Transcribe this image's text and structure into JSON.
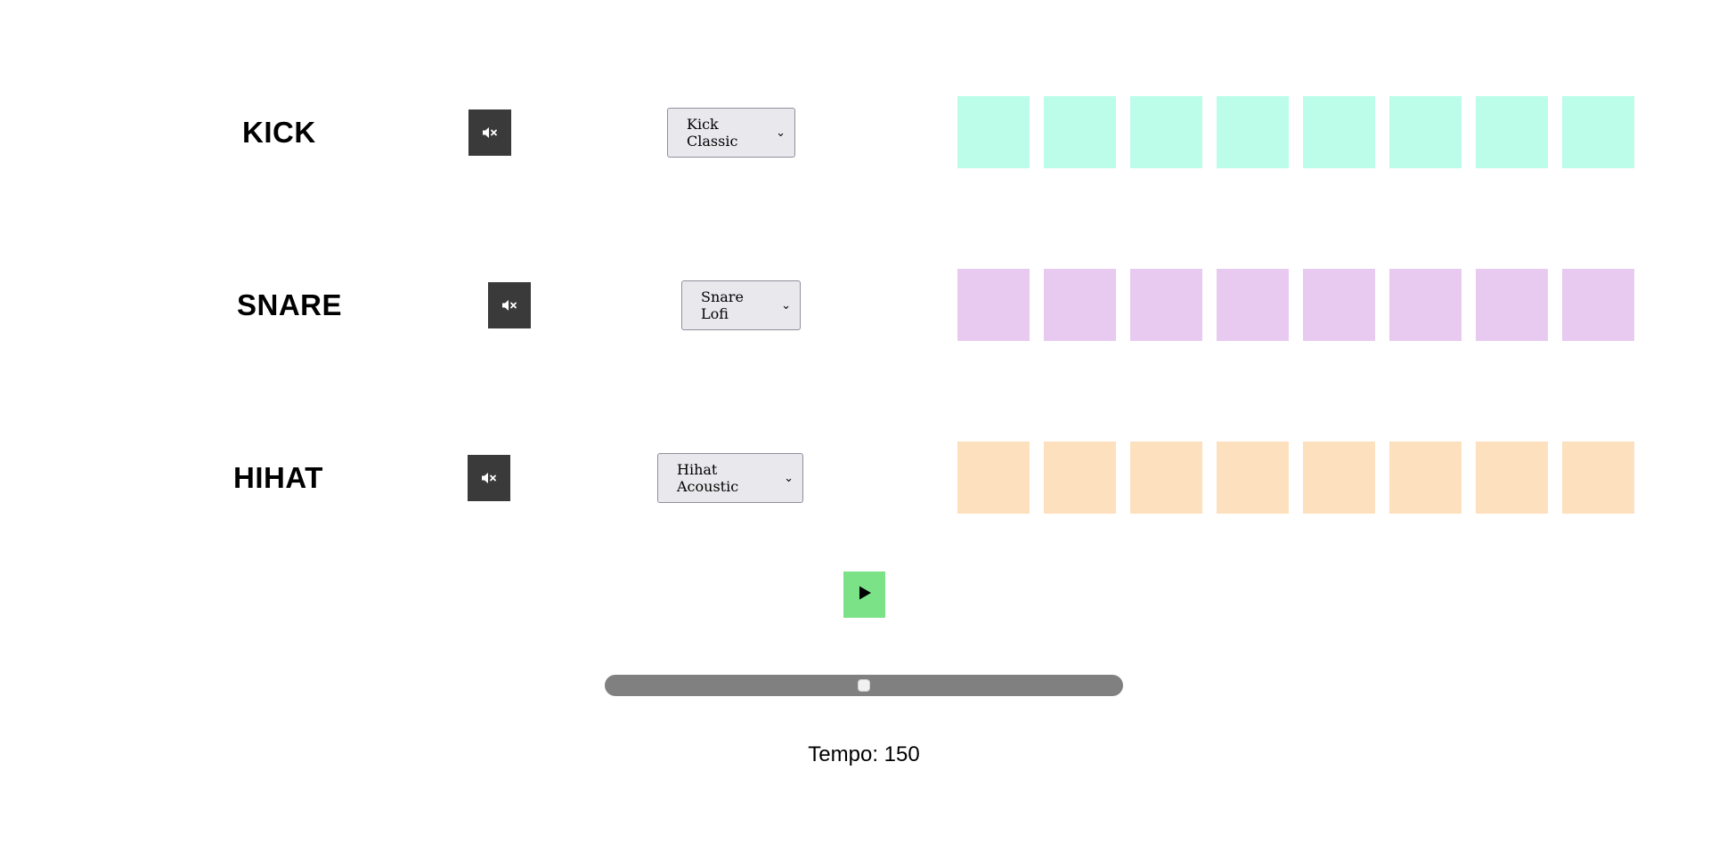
{
  "tracks": [
    {
      "name": "KICK",
      "selected_sound": "Kick Classic",
      "step_color": "#bcfde9",
      "steps": [
        false,
        false,
        false,
        false,
        false,
        false,
        false,
        false
      ]
    },
    {
      "name": "SNARE",
      "selected_sound": "Snare Lofi",
      "step_color": "#e8caf0",
      "steps": [
        false,
        false,
        false,
        false,
        false,
        false,
        false,
        false
      ]
    },
    {
      "name": "HIHAT",
      "selected_sound": "Hihat Acoustic",
      "step_color": "#fde0be",
      "steps": [
        false,
        false,
        false,
        false,
        false,
        false,
        false,
        false
      ]
    }
  ],
  "mute_icon": "speaker-muted-icon",
  "mute_button_color": "#3a3a3a",
  "play_button": {
    "icon": "play-icon",
    "color": "#7be287"
  },
  "tempo": {
    "label": "Tempo: 150",
    "value": 150,
    "position_fraction": 0.5
  }
}
